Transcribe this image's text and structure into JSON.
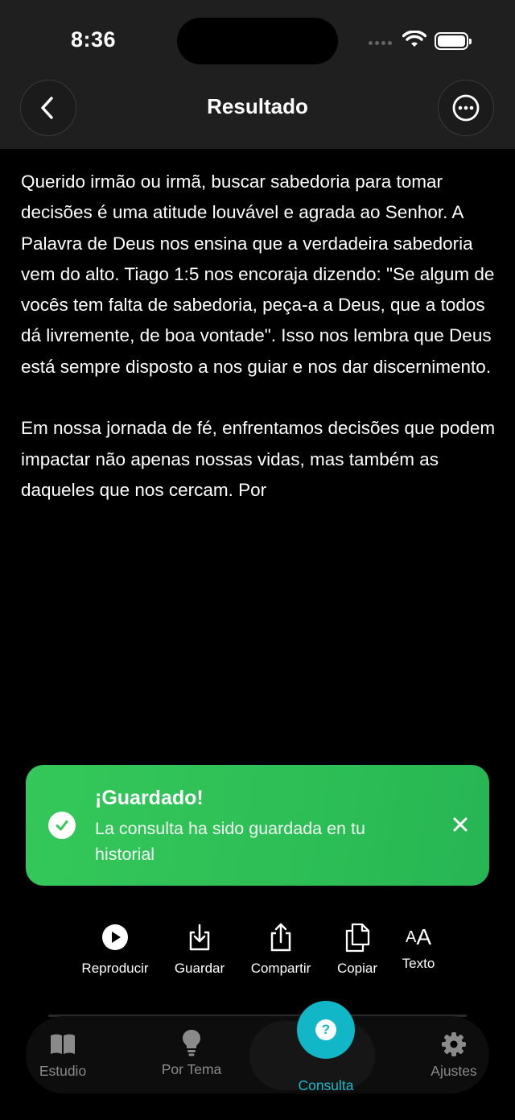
{
  "status_bar": {
    "time": "8:36"
  },
  "header": {
    "title": "Resultado"
  },
  "content": {
    "paragraphs": [
      "Querido irmão ou irmã, buscar sabedoria para tomar decisões é uma atitude louvável e agrada ao Senhor. A Palavra de Deus nos ensina que a verdadeira sabedoria vem do alto. Tiago 1:5 nos encoraja dizendo: \"Se algum de vocês tem falta de sabedoria, peça-a a Deus, que a todos dá livremente, de boa vontade\". Isso nos lembra que Deus está sempre disposto a nos guiar e nos dar discernimento.",
      "Em nossa jornada de fé, enfrentamos decisões que podem impactar não apenas nossas vidas, mas também as daqueles que nos cercam. Por"
    ]
  },
  "toast": {
    "title": "¡Guardado!",
    "message": "La consulta ha sido guardada en tu historial",
    "color": "#34c759"
  },
  "actions": {
    "play": "Reproducir",
    "save": "Guardar",
    "share": "Compartir",
    "copy": "Copiar",
    "text": "Texto",
    "text_icon": "AA"
  },
  "tabs": {
    "estudio": "Estudio",
    "por_tema": "Por Tema",
    "consulta": "Consulta",
    "ajustes": "Ajustes",
    "active": "consulta",
    "accent": "#12b7c7"
  }
}
